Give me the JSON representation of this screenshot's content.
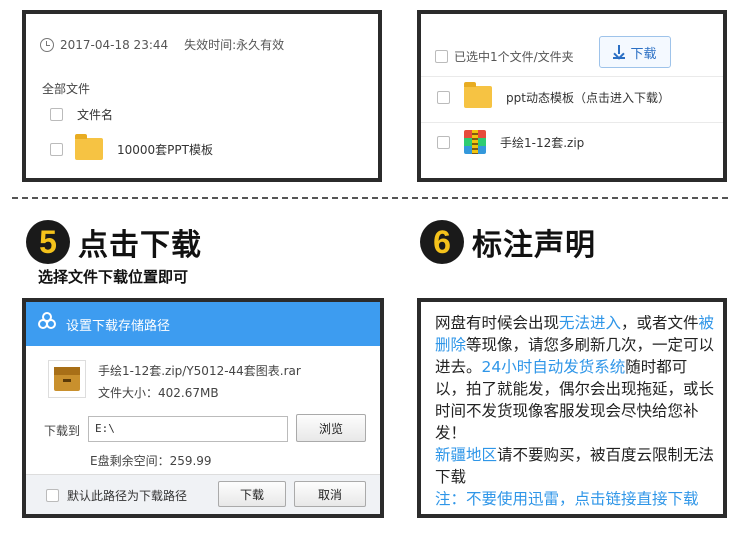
{
  "panel1": {
    "timestamp": "2017-04-18 23:44",
    "validity": "失效时间:永久有效",
    "all_files": "全部文件",
    "filename_header": "文件名",
    "file_name": "10000套PPT模板"
  },
  "panel2": {
    "selected_text": "已选中1个文件/文件夹",
    "download_label": "下载",
    "files": [
      "ppt动态模板（点击进入下载）",
      "手绘1-12套.zip"
    ]
  },
  "step5": {
    "number": "5",
    "title": "点击下载",
    "subtitle": "选择文件下载位置即可"
  },
  "step6": {
    "number": "6",
    "title": "标注声明"
  },
  "dialog": {
    "title": "设置下载存储路径",
    "file_names": "手绘1-12套.zip/Y5012-44套图表.rar",
    "file_size": "文件大小：402.67MB",
    "download_to_label": "下载到",
    "path_value": "E:\\",
    "browse_label": "浏览",
    "free_space": "E盘剩余空间：259.99",
    "default_path_label": "默认此路径为下载路径",
    "download_label": "下载",
    "cancel_label": "取消"
  },
  "notice": {
    "t1": "网盘有时候会出现",
    "t2": "无法进入",
    "t3": "，或者文件",
    "t4": "被删除",
    "t5": "等现像，请您多刷新几次，一定可以进去。",
    "t6": "24小时自动发货系统",
    "t7": "随时都可以，拍了就能发，偶尔会出现拖延，或长时间不发货现像客服发现会尽快给您补发！",
    "t8": "新疆地区",
    "t9": "请不要购买，被百度云限制无法下载",
    "t10": "注：不要使用迅雷，点击链接直接下载"
  },
  "colors": {
    "accent": "#3d9cf0",
    "highlight": "#2f96e8",
    "step_number": "#f4c21b"
  }
}
